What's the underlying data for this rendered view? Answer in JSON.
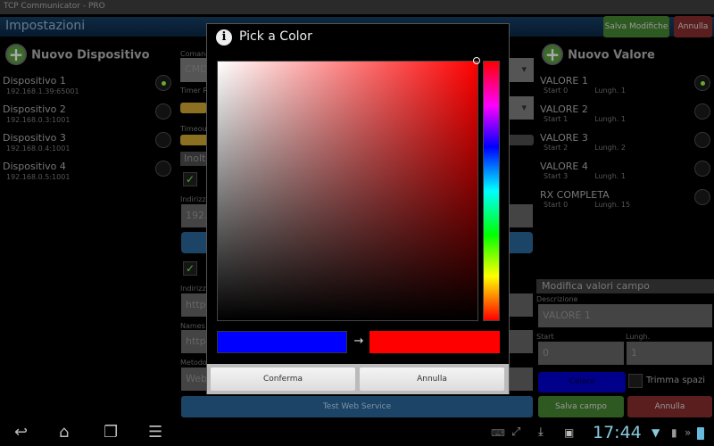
{
  "app_title": "TCP Communicator - PRO",
  "header": {
    "title": "Impostazioni",
    "save_label": "Salva Modifiche",
    "cancel_label": "Annulla"
  },
  "devices": {
    "title": "Nuovo Dispositivo",
    "items": [
      {
        "name": "Dispositivo 1",
        "addr": "192.168.1.39:65001",
        "selected": true
      },
      {
        "name": "Dispositivo 2",
        "addr": "192.168.0.3:1001",
        "selected": false
      },
      {
        "name": "Dispositivo 3",
        "addr": "192.168.0.4:1001",
        "selected": false
      },
      {
        "name": "Dispositivo 4",
        "addr": "192.168.0.5:1001",
        "selected": false
      }
    ]
  },
  "middle": {
    "comandi_label": "Comandi",
    "comandi_value": "CMD",
    "timer_label": "Timer R",
    "timeout_label": "Timeout",
    "inoltro_label": "Inoltr",
    "check1": "A",
    "indirizzo_label": "Indirizz",
    "indirizzo_value": "192.",
    "check2": "A",
    "indirizzo2_label": "Indirizz",
    "indirizzo2_value": "http:",
    "names_label": "Names",
    "names_value": "http:",
    "metodo_label": "Metodo",
    "metodo_value": "Web",
    "test_button": "Test Web Service"
  },
  "values": {
    "title": "Nuovo Valore",
    "items": [
      {
        "name": "VALORE 1",
        "start": "Start 0",
        "len": "Lungh. 1",
        "selected": true
      },
      {
        "name": "VALORE 2",
        "start": "Start 1",
        "len": "Lungh. 1",
        "selected": false
      },
      {
        "name": "VALORE 3",
        "start": "Start 2",
        "len": "Lungh. 2",
        "selected": false
      },
      {
        "name": "VALORE 4",
        "start": "Start 3",
        "len": "Lungh. 1",
        "selected": false
      },
      {
        "name": "RX COMPLETA",
        "start": "Start 0",
        "len": "Lungh. 15",
        "selected": false
      }
    ]
  },
  "edit": {
    "title": "Modifica valori campo",
    "desc_label": "Descrizione",
    "desc_value": "VALORE 1",
    "start_label": "Start",
    "start_value": "0",
    "len_label": "Lungh.",
    "len_value": "1",
    "color_button": "Colore",
    "trim_label": "Trimma spazi",
    "save_button": "Salva campo",
    "cancel_button": "Annulla"
  },
  "dialog": {
    "title": "Pick a Color",
    "old_color": "#0000ff",
    "new_color": "#ff0000",
    "arrow": "→",
    "confirm": "Conferma",
    "cancel": "Annulla"
  },
  "status": {
    "time": "17:44"
  }
}
